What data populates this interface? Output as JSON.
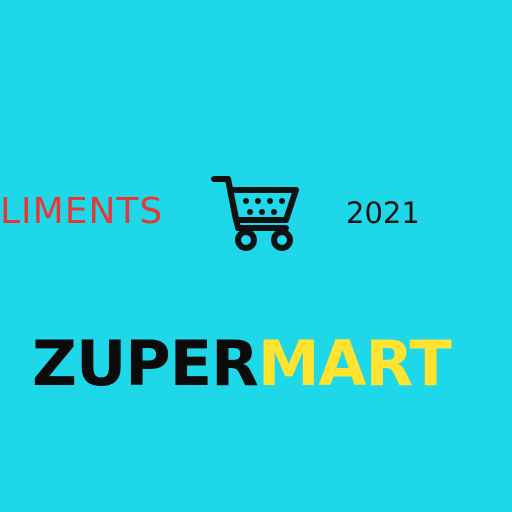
{
  "logo": {
    "top_text": "LIMENTS",
    "year": "2021",
    "brand_primary": "ZUPER",
    "brand_secondary": "MART",
    "icon": "shopping-cart-icon"
  },
  "colors": {
    "background": "#1ed8ea",
    "top_text": "#e53935",
    "year": "#141414",
    "brand_primary": "#0b0b0b",
    "brand_secondary": "#ffe32e"
  }
}
